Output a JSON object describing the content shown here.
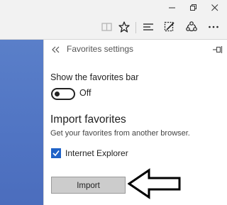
{
  "window": {
    "buttons": [
      "minimize",
      "restore",
      "close"
    ]
  },
  "toolbar": {
    "icons": [
      "reading-view-icon",
      "favorite-star-icon",
      "hub-icon",
      "web-note-icon",
      "share-icon",
      "more-icon"
    ]
  },
  "panel": {
    "title": "Favorites settings",
    "favorites_bar": {
      "label": "Show the favorites bar",
      "state": "Off"
    },
    "import": {
      "heading": "Import favorites",
      "description": "Get your favorites from another browser.",
      "browsers": [
        {
          "label": "Internet Explorer",
          "checked": true
        }
      ],
      "button_label": "Import"
    }
  },
  "colors": {
    "accent": "#1f62c7",
    "page_background": "#5074c3",
    "button_gray": "#cccccc"
  }
}
